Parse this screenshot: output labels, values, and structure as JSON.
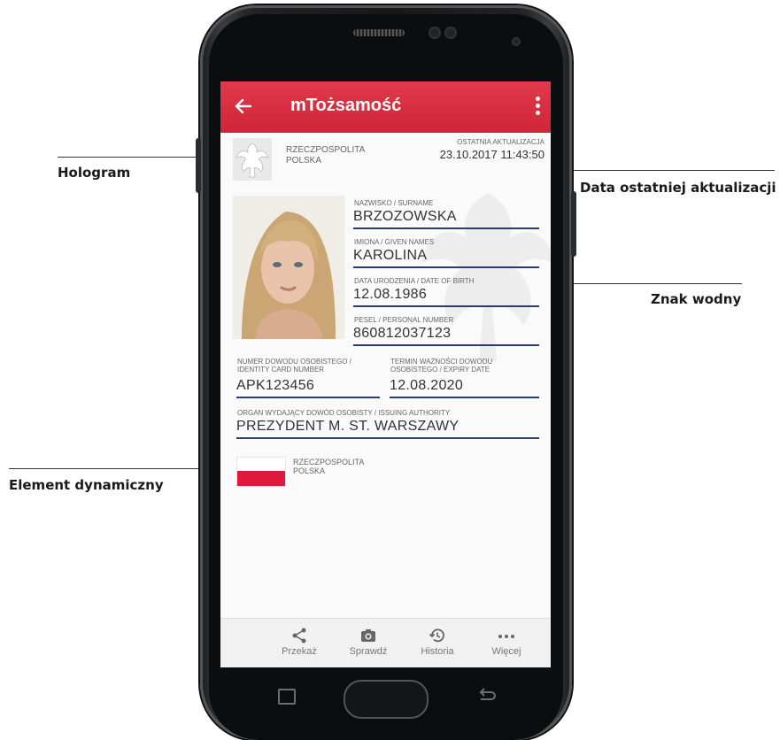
{
  "callouts": {
    "hologram": "Hologram",
    "data_aktualizacji": "Data ostatniej aktualizacji",
    "znak_wodny": "Znak wodny",
    "element_dynamiczny": "Element dynamiczny"
  },
  "appbar": {
    "title": "mTożsamość",
    "color": "#d62b3f"
  },
  "card": {
    "header_country": "RZECZPOSPOLITA\nPOLSKA",
    "last_update_label": "OSTATNIA AKTUALIZACJA",
    "last_update_value": "23.10.2017 11:43:50",
    "surname_label": "NAZWISKO / SURNAME",
    "surname_value": "BRZOZOWSKA",
    "given_label": "IMIONA / GIVEN NAMES",
    "given_value": "KAROLINA",
    "dob_label": "DATA URODZENIA / DATE OF BIRTH",
    "dob_value": "12.08.1986",
    "pesel_label": "PESEL / PERSONAL NUMBER",
    "pesel_value": "860812037123",
    "idnum_label": "NUMER DOWODU OSOBISTEGO /\nIDENTITY CARD NUMBER",
    "idnum_value": "APK123456",
    "expiry_label": "TERMIN WAŻNOŚCI DOWODU\nOSOBISTEGO / EXPIRY DATE",
    "expiry_value": "12.08.2020",
    "authority_label": "ORGAN WYDAJĄCY DOWÓD OSOBISTY / ISSUING AUTHORITY",
    "authority_value": "PREZYDENT M. ST. WARSZAWY",
    "flag_country": "RZECZPOSPOLITA\nPOLSKA",
    "underline_color": "#2a3c74",
    "flag_red": "#dc1a3b"
  },
  "bottom_nav": [
    {
      "label": "Przekaż",
      "icon": "share-icon"
    },
    {
      "label": "Sprawdź",
      "icon": "camera-icon"
    },
    {
      "label": "Historia",
      "icon": "history-icon"
    },
    {
      "label": "Więcej",
      "icon": "more-icon"
    }
  ]
}
